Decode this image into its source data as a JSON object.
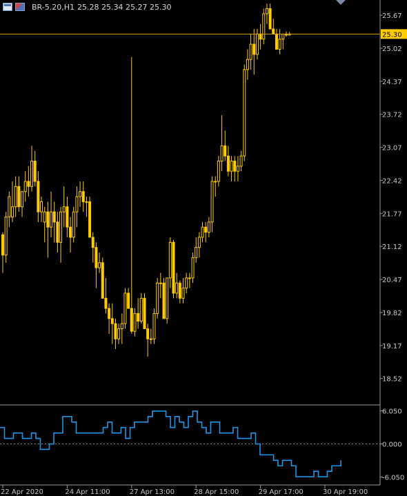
{
  "header": {
    "symbol": "BR-5.20,H1",
    "ohlc": "25.28 25.34 25.27 25.30",
    "icons": [
      "chart-window-icon",
      "trade-icon"
    ]
  },
  "colors": {
    "background": "#000000",
    "candle": "#ffcc00",
    "price_line": "#d9a400",
    "price_tag_bg": "#ffcc00",
    "price_tag_text": "#000000",
    "indicator": "#1e96e6",
    "zero_line": "#8c8c8c",
    "axis_text": "#c8c8c8",
    "separator": "#9a9a9a"
  },
  "chart_data": [
    {
      "type": "candlestick",
      "title": "BR-5.20,H1",
      "current_price": 25.3,
      "current_price_label": "25.30",
      "y_ticks": [
        "25.67",
        "25.02",
        "24.37",
        "23.72",
        "23.07",
        "22.42",
        "21.77",
        "21.12",
        "20.47",
        "19.82",
        "19.17",
        "18.52"
      ],
      "ylim": [
        18.0,
        25.97
      ],
      "grid": false,
      "x_labels": [
        {
          "label": "22 Apr 2020",
          "bar": 0
        },
        {
          "label": "24 Apr 11:00",
          "bar": 20
        },
        {
          "label": "27 Apr 13:00",
          "bar": 40
        },
        {
          "label": "28 Apr 15:00",
          "bar": 60
        },
        {
          "label": "29 Apr 17:00",
          "bar": 80
        },
        {
          "label": "30 Apr 19:00",
          "bar": 100
        }
      ],
      "ohlc": [
        [
          21.35,
          21.4,
          20.6,
          20.95
        ],
        [
          20.95,
          21.8,
          20.8,
          21.7
        ],
        [
          21.7,
          22.2,
          21.5,
          22.1
        ],
        [
          21.7,
          22.4,
          21.6,
          21.9
        ],
        [
          21.9,
          22.5,
          21.7,
          22.3
        ],
        [
          22.3,
          22.5,
          21.8,
          21.9
        ],
        [
          21.9,
          22.2,
          21.7,
          22.2
        ],
        [
          22.2,
          22.6,
          22.0,
          22.4
        ],
        [
          22.4,
          22.7,
          22.1,
          22.3
        ],
        [
          22.3,
          23.1,
          22.2,
          22.8
        ],
        [
          22.8,
          23.0,
          22.3,
          22.4
        ],
        [
          22.4,
          22.6,
          21.6,
          21.8
        ],
        [
          21.8,
          22.1,
          21.6,
          22.0
        ],
        [
          21.6,
          21.9,
          21.2,
          21.8
        ],
        [
          21.8,
          22.0,
          20.9,
          21.5
        ],
        [
          21.5,
          22.2,
          21.3,
          21.8
        ],
        [
          21.8,
          22.0,
          21.2,
          21.6
        ],
        [
          21.6,
          21.8,
          21.0,
          21.2
        ],
        [
          21.2,
          21.9,
          20.8,
          21.8
        ],
        [
          21.8,
          22.3,
          21.5,
          21.9
        ],
        [
          21.9,
          22.1,
          21.3,
          21.5
        ],
        [
          21.5,
          21.7,
          21.0,
          21.3
        ],
        [
          21.3,
          21.9,
          21.2,
          21.8
        ],
        [
          21.8,
          22.3,
          21.5,
          22.1
        ],
        [
          22.1,
          22.4,
          21.9,
          22.2
        ],
        [
          22.2,
          22.4,
          21.8,
          22.0
        ],
        [
          22.0,
          22.1,
          21.7,
          22.0
        ],
        [
          22.0,
          22.1,
          21.3,
          21.3
        ],
        [
          21.3,
          21.4,
          20.8,
          21.1
        ],
        [
          21.1,
          21.2,
          20.3,
          20.7
        ],
        [
          20.7,
          21.0,
          20.6,
          20.8
        ],
        [
          20.8,
          20.9,
          20.2,
          20.1
        ],
        [
          20.1,
          20.5,
          19.8,
          19.9
        ],
        [
          19.9,
          20.0,
          19.4,
          19.7
        ],
        [
          19.7,
          20.0,
          19.2,
          19.6
        ],
        [
          19.6,
          19.7,
          19.1,
          19.3
        ],
        [
          19.3,
          19.6,
          19.2,
          19.5
        ],
        [
          19.5,
          19.8,
          19.2,
          19.6
        ],
        [
          19.6,
          20.3,
          19.5,
          20.2
        ],
        [
          20.2,
          20.3,
          19.9,
          19.9
        ],
        [
          19.9,
          24.85,
          19.4,
          19.45
        ],
        [
          19.45,
          19.9,
          19.35,
          19.8
        ],
        [
          19.8,
          20.1,
          19.5,
          19.65
        ],
        [
          19.65,
          20.2,
          19.6,
          20.1
        ],
        [
          20.1,
          20.2,
          19.5,
          19.5
        ],
        [
          19.5,
          19.6,
          18.95,
          19.3
        ],
        [
          19.3,
          19.5,
          19.2,
          19.3
        ],
        [
          19.3,
          19.9,
          19.2,
          19.8
        ],
        [
          19.8,
          20.5,
          19.7,
          20.4
        ],
        [
          20.4,
          20.6,
          20.1,
          20.4
        ],
        [
          20.4,
          20.5,
          19.8,
          19.7
        ],
        [
          19.7,
          20.5,
          19.6,
          20.5
        ],
        [
          20.5,
          21.3,
          20.3,
          21.2
        ],
        [
          21.2,
          21.25,
          20.1,
          20.2
        ],
        [
          20.2,
          20.6,
          20.1,
          20.4
        ],
        [
          20.4,
          20.45,
          20.0,
          20.1
        ],
        [
          20.1,
          20.5,
          20.0,
          20.3
        ],
        [
          20.3,
          20.6,
          20.2,
          20.5
        ],
        [
          20.5,
          20.6,
          20.3,
          20.5
        ],
        [
          20.5,
          21.0,
          20.4,
          20.9
        ],
        [
          20.9,
          21.3,
          20.8,
          21.1
        ],
        [
          21.1,
          21.4,
          20.9,
          21.3
        ],
        [
          21.3,
          21.6,
          21.2,
          21.5
        ],
        [
          21.5,
          21.6,
          21.2,
          21.4
        ],
        [
          21.4,
          21.7,
          21.3,
          21.6
        ],
        [
          21.6,
          22.5,
          21.4,
          22.4
        ],
        [
          22.4,
          22.5,
          22.1,
          22.4
        ],
        [
          22.4,
          22.9,
          22.3,
          22.8
        ],
        [
          22.8,
          23.7,
          22.6,
          23.1
        ],
        [
          23.1,
          23.4,
          22.8,
          22.9
        ],
        [
          22.9,
          23.1,
          22.5,
          22.6
        ],
        [
          22.6,
          22.9,
          22.4,
          22.8
        ],
        [
          22.8,
          22.9,
          22.4,
          22.6
        ],
        [
          22.6,
          22.9,
          22.4,
          22.7
        ],
        [
          22.7,
          23.0,
          22.6,
          22.9
        ],
        [
          22.9,
          24.7,
          22.8,
          24.6
        ],
        [
          24.6,
          25.0,
          24.4,
          24.8
        ],
        [
          24.8,
          25.3,
          24.6,
          25.1
        ],
        [
          25.1,
          25.4,
          24.5,
          24.9
        ],
        [
          24.9,
          25.4,
          24.8,
          25.3
        ],
        [
          25.3,
          25.5,
          25.0,
          25.2
        ],
        [
          25.2,
          25.8,
          25.1,
          25.7
        ],
        [
          25.7,
          25.9,
          25.5,
          25.8
        ],
        [
          25.8,
          25.9,
          25.4,
          25.4
        ],
        [
          25.4,
          25.6,
          25.3,
          25.3
        ],
        [
          25.3,
          25.4,
          25.0,
          25.0
        ],
        [
          25.0,
          25.4,
          24.9,
          25.2
        ],
        [
          25.2,
          25.3,
          25.0,
          25.3
        ],
        [
          25.3,
          25.35,
          25.25,
          25.28
        ],
        [
          25.28,
          25.34,
          25.27,
          25.3
        ]
      ]
    },
    {
      "type": "line",
      "series": [
        {
          "values": [
            3,
            1,
            1,
            2,
            2,
            1,
            1,
            2,
            1,
            -1,
            -1,
            0,
            2,
            2,
            5,
            5,
            4,
            2,
            2,
            2,
            2,
            2,
            2,
            3,
            4,
            2,
            2,
            3,
            1,
            3,
            4,
            4,
            4,
            5,
            6,
            6,
            6,
            5,
            3,
            5,
            4,
            3,
            5,
            6,
            4,
            3,
            2,
            4,
            4,
            2,
            2,
            2,
            3,
            1,
            1,
            1,
            2,
            0,
            -2,
            -2,
            -2,
            -3,
            -4,
            -3,
            -3,
            -4,
            -6,
            -6,
            -6,
            -6,
            -5,
            -6,
            -6,
            -5,
            -4,
            -4,
            -3
          ]
        }
      ],
      "y_ticks": [
        "6.050",
        "0.000",
        "-6.050"
      ],
      "ylim": [
        -7.5,
        7.0
      ]
    }
  ]
}
